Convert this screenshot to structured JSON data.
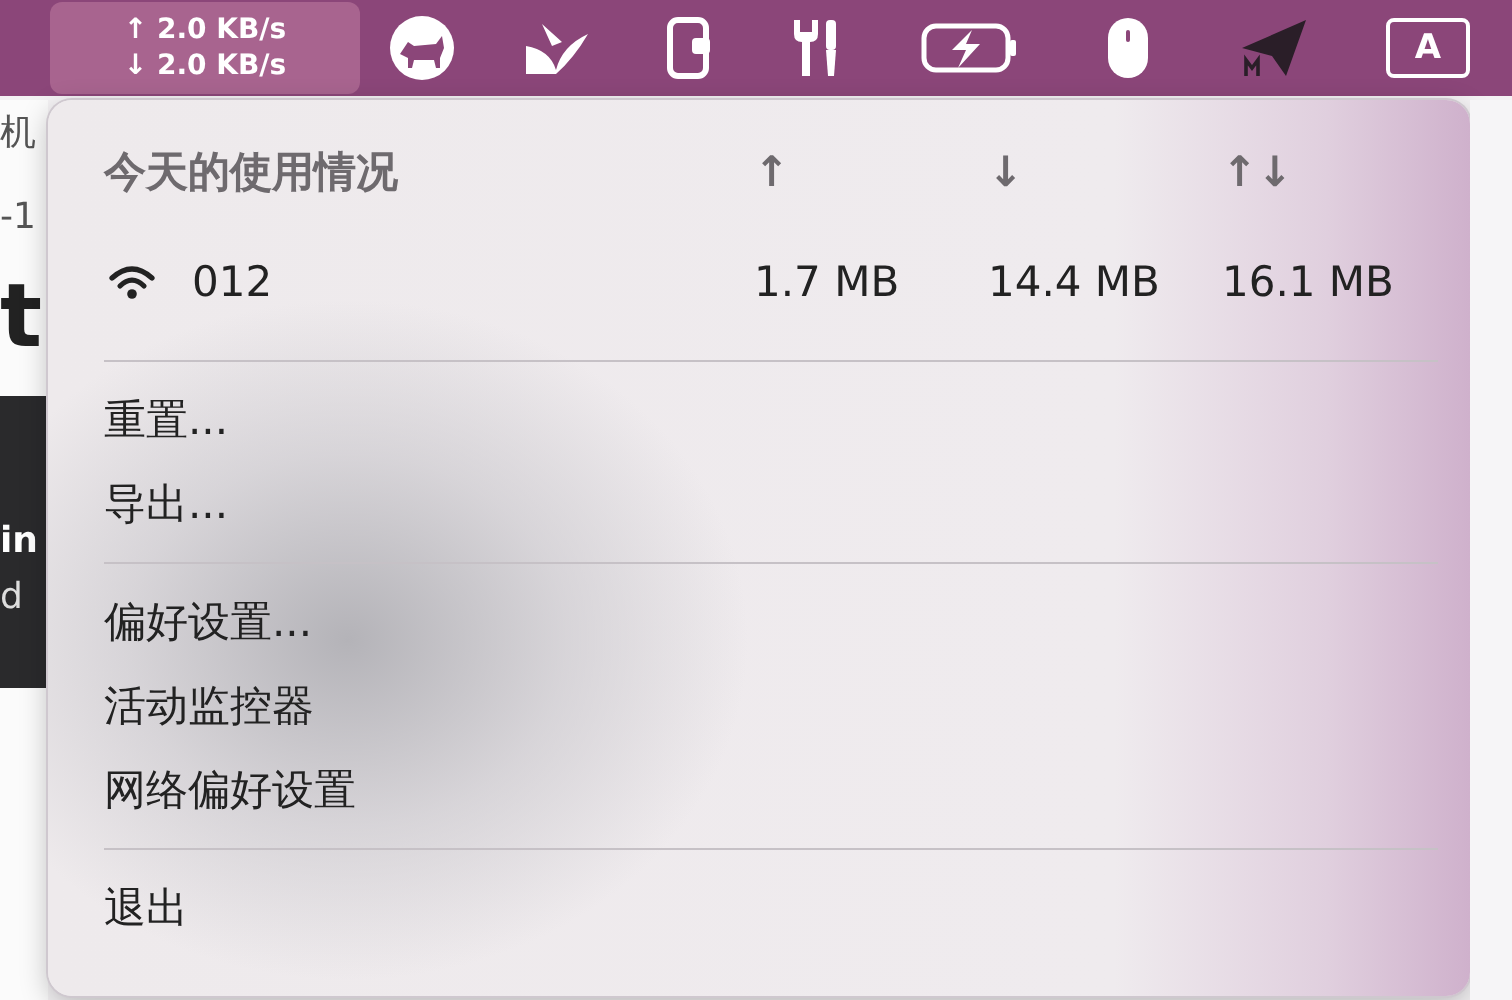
{
  "menu_bar": {
    "network_speed": {
      "upload": "↑ 2.0 KB/s",
      "download": "↓ 2.0 KB/s"
    },
    "input_source": "A"
  },
  "background_window": {
    "fragments": [
      {
        "kind": "small",
        "text": "机"
      },
      {
        "kind": "small",
        "text": "-1"
      },
      {
        "kind": "large",
        "text": "t"
      },
      {
        "kind": "dark-bold",
        "text": "in"
      },
      {
        "kind": "dark",
        "text": "d"
      }
    ]
  },
  "usage": {
    "title": "今天的使用情况",
    "columns": [
      "↑",
      "↓",
      "↑↓"
    ],
    "rows": [
      {
        "name": "012",
        "values": [
          "1.7 MB",
          "14.4 MB",
          "16.1 MB"
        ]
      }
    ]
  },
  "menu_groups": [
    {
      "items": [
        {
          "label": "重置..."
        },
        {
          "label": "导出..."
        }
      ]
    },
    {
      "items": [
        {
          "label": "偏好设置..."
        },
        {
          "label": "活动监控器"
        },
        {
          "label": "网络偏好设置"
        }
      ]
    },
    {
      "items": [
        {
          "label": "退出"
        }
      ]
    }
  ]
}
